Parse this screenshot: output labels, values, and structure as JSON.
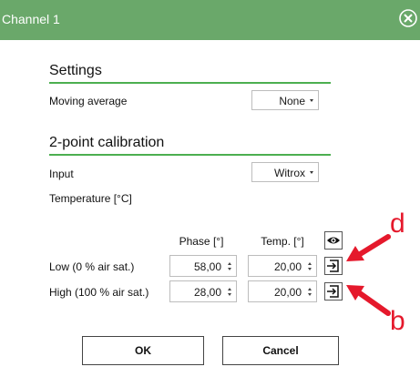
{
  "window": {
    "title": "Channel 1",
    "accent": "#6aa86a",
    "close_icon": "close-circle-x"
  },
  "settings": {
    "title": "Settings",
    "moving_average": {
      "label": "Moving average",
      "value": "None"
    }
  },
  "calibration": {
    "title": "2-point calibration",
    "input": {
      "label": "Input",
      "value": "Witrox"
    },
    "temperature_label": "Temperature [°C]",
    "columns": {
      "phase": "Phase [°]",
      "temp": "Temp. [°]"
    },
    "eye_icon": "eye-icon",
    "rows": [
      {
        "label": "Low (0 % air sat.)",
        "phase": "58,00",
        "temp": "20,00",
        "icon": "import-value-icon"
      },
      {
        "label": "High (100 % air sat.)",
        "phase": "28,00",
        "temp": "20,00",
        "icon": "import-value-icon"
      }
    ]
  },
  "annotations": {
    "d": "d",
    "b": "b",
    "color": "#e5192c"
  },
  "buttons": {
    "ok": "OK",
    "cancel": "Cancel"
  }
}
